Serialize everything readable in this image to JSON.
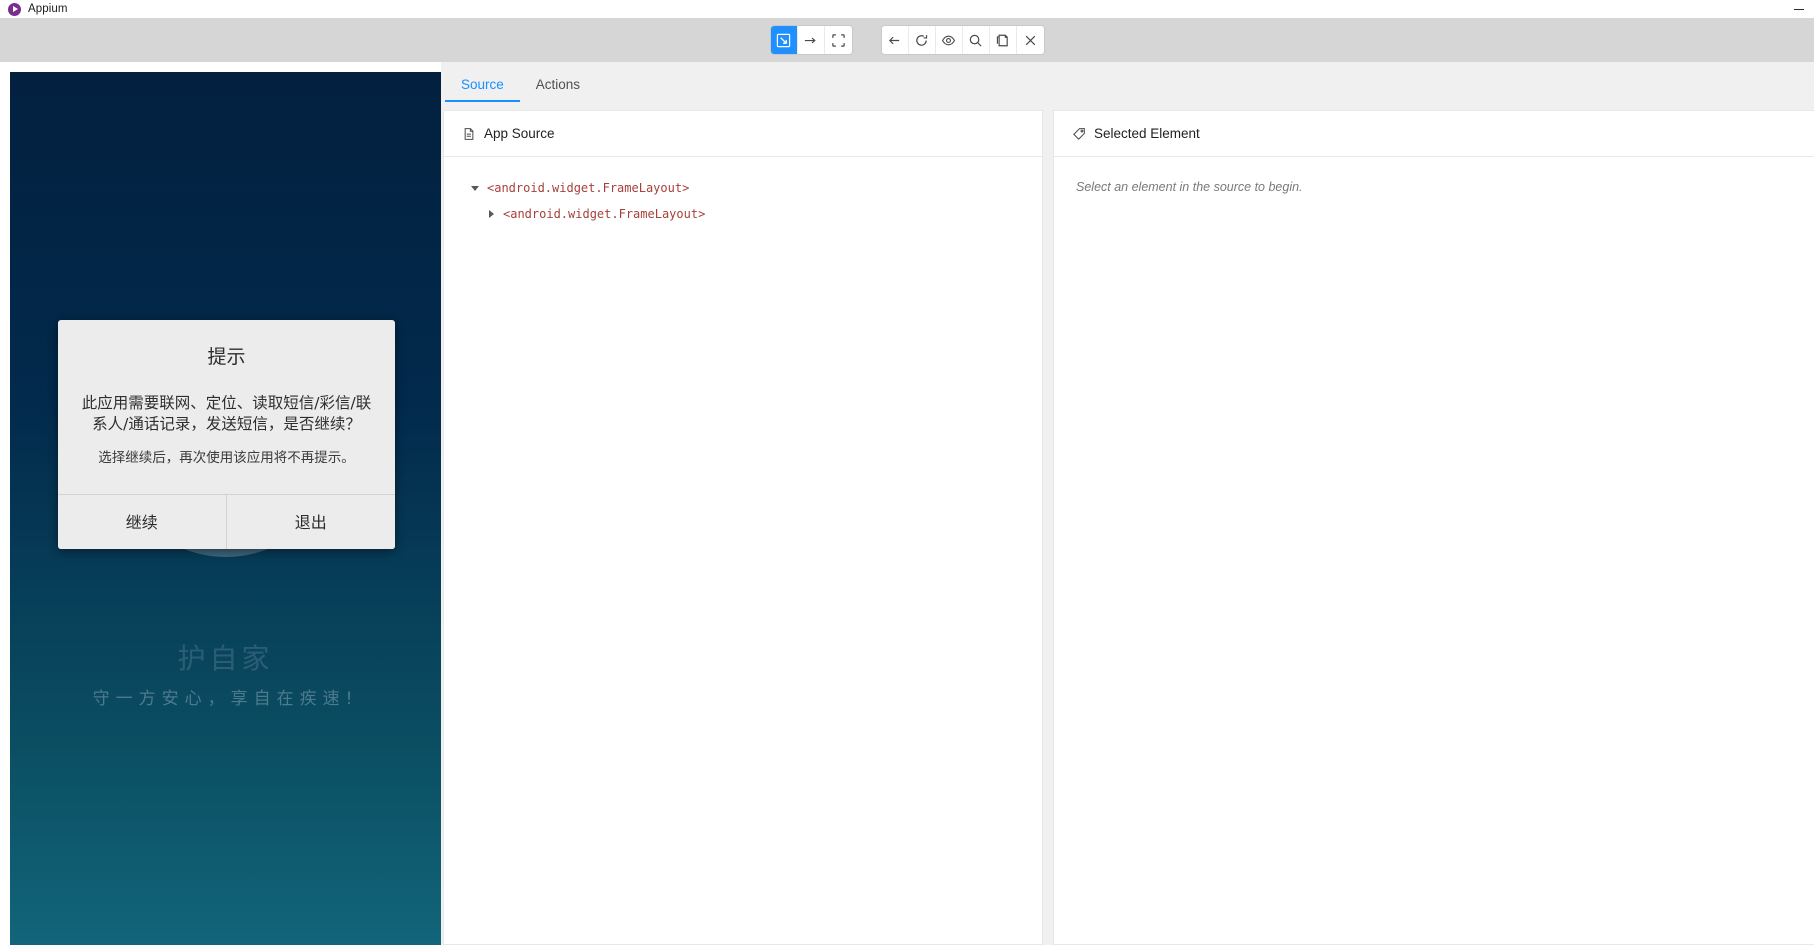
{
  "window": {
    "title": "Appium",
    "logo_icon": "appium-logo-icon",
    "minimize_label": "minimize-icon"
  },
  "toolbar": {
    "group_left": [
      {
        "name": "select-element-tool",
        "icon": "cursor-select-icon",
        "active": true
      },
      {
        "name": "swipe-tool",
        "icon": "arrow-right-icon",
        "active": false
      },
      {
        "name": "tap-by-coordinates-tool",
        "icon": "crosshair-frame-icon",
        "active": false
      }
    ],
    "group_right": [
      {
        "name": "back-button",
        "icon": "arrow-left-icon"
      },
      {
        "name": "refresh-source-button",
        "icon": "refresh-icon"
      },
      {
        "name": "toggle-visibility-button",
        "icon": "eye-icon"
      },
      {
        "name": "search-element-button",
        "icon": "magnifier-icon"
      },
      {
        "name": "copy-source-button",
        "icon": "copy-icon"
      },
      {
        "name": "quit-session-button",
        "icon": "close-x-icon"
      }
    ]
  },
  "tabs": [
    {
      "label": "Source",
      "active": true
    },
    {
      "label": "Actions",
      "active": false
    }
  ],
  "source_panel": {
    "title": "App Source",
    "icon": "file-document-icon",
    "tree": [
      {
        "label": "<android.widget.FrameLayout>",
        "level": 0,
        "expanded": true
      },
      {
        "label": "<android.widget.FrameLayout>",
        "level": 1,
        "expanded": false
      }
    ]
  },
  "selected_panel": {
    "title": "Selected Element",
    "icon": "tag-icon",
    "empty_message": "Select an element in the source to begin."
  },
  "device": {
    "brand_mark": "护自家",
    "tagline": "守一方安心，享自在疾速!",
    "dialog": {
      "title": "提示",
      "message": "此应用需要联网、定位、读取短信/彩信/联系人/通话记录，发送短信，是否继续？",
      "sub_message": "选择继续后，再次使用该应用将不再提示。",
      "buttons": [
        {
          "label": "继续"
        },
        {
          "label": "退出"
        }
      ]
    }
  },
  "colors": {
    "accent": "#1890ff",
    "toolbar_bg": "#d6d6d6",
    "tree_tag": "#a8403a",
    "device_top": "#03203f",
    "device_bottom": "#12657a"
  }
}
